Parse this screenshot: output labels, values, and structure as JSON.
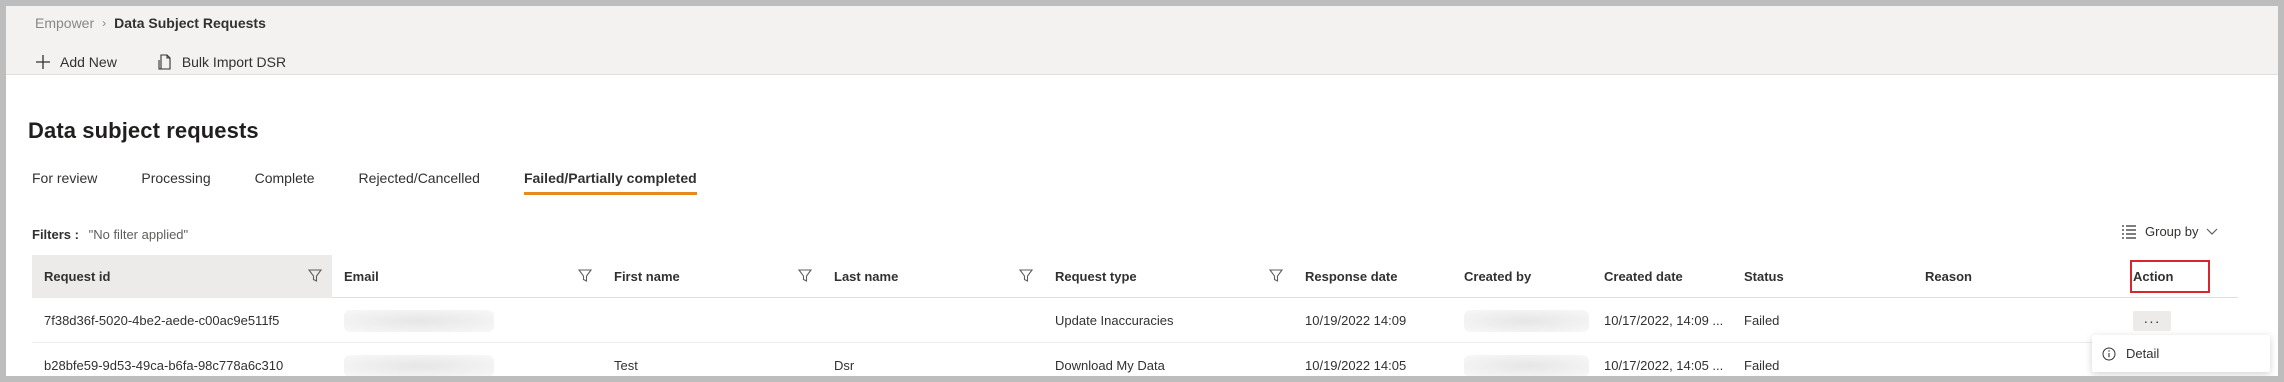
{
  "breadcrumb": {
    "root": "Empower",
    "current": "Data Subject Requests"
  },
  "toolbar": {
    "add_new": "Add New",
    "bulk_import": "Bulk Import DSR"
  },
  "page": {
    "title": "Data subject requests"
  },
  "tabs": [
    {
      "label": "For review"
    },
    {
      "label": "Processing"
    },
    {
      "label": "Complete"
    },
    {
      "label": "Rejected/Cancelled"
    },
    {
      "label": "Failed/Partially completed",
      "active": true
    }
  ],
  "filters": {
    "label": "Filters :",
    "value": "\"No filter applied\""
  },
  "group_by": {
    "label": "Group by"
  },
  "table": {
    "columns": [
      "Request id",
      "Email",
      "First name",
      "Last name",
      "Request type",
      "Response date",
      "Created by",
      "Created date",
      "Status",
      "Reason",
      "Action"
    ],
    "rows": [
      {
        "request_id": "7f38d36f-5020-4be2-aede-c00ac9e511f5",
        "first_name": "",
        "last_name": "",
        "request_type": "Update Inaccuracies",
        "response_date": "10/19/2022 14:09",
        "created_date": "10/17/2022, 14:09 ...",
        "status": "Failed",
        "reason": ""
      },
      {
        "request_id": "b28bfe59-9d53-49ca-b6fa-98c778a6c310",
        "first_name": "Test",
        "last_name": "Dsr",
        "request_type": "Download My Data",
        "response_date": "10/19/2022 14:05",
        "created_date": "10/17/2022, 14:05 ...",
        "status": "Failed",
        "reason": ""
      }
    ]
  },
  "row_action": {
    "more_label": "···"
  },
  "context_menu": {
    "detail": "Detail"
  },
  "colors": {
    "accent": "#e8891c",
    "highlight": "#d9262c"
  }
}
